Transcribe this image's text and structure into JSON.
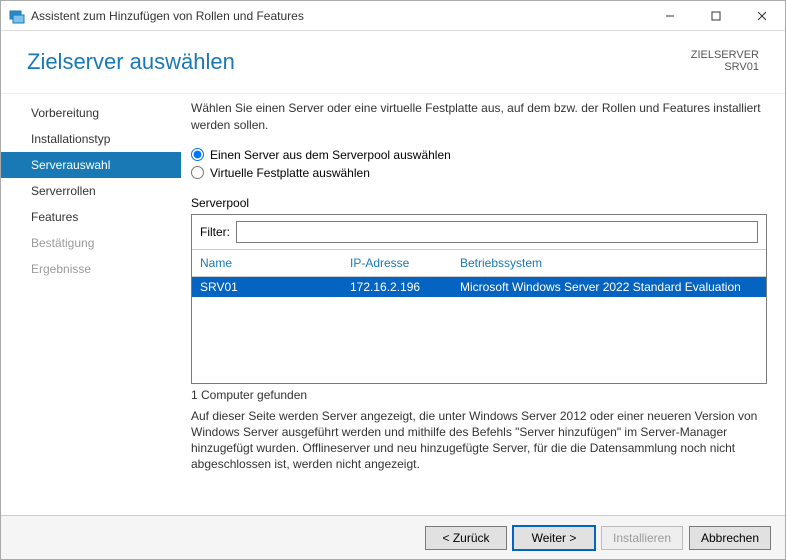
{
  "window": {
    "title": "Assistent zum Hinzufügen von Rollen und Features"
  },
  "header": {
    "page_title": "Zielserver auswählen",
    "destination_label": "ZIELSERVER",
    "destination_value": "SRV01"
  },
  "sidebar": {
    "items": [
      {
        "label": "Vorbereitung",
        "selected": false,
        "disabled": false
      },
      {
        "label": "Installationstyp",
        "selected": false,
        "disabled": false
      },
      {
        "label": "Serverauswahl",
        "selected": true,
        "disabled": false
      },
      {
        "label": "Serverrollen",
        "selected": false,
        "disabled": false
      },
      {
        "label": "Features",
        "selected": false,
        "disabled": false
      },
      {
        "label": "Bestätigung",
        "selected": false,
        "disabled": true
      },
      {
        "label": "Ergebnisse",
        "selected": false,
        "disabled": true
      }
    ]
  },
  "main": {
    "instruction": "Wählen Sie einen Server oder eine virtuelle Festplatte aus, auf dem bzw. der Rollen und Features installiert werden sollen.",
    "radio_pool": "Einen Server aus dem Serverpool auswählen",
    "radio_vhd": "Virtuelle Festplatte auswählen",
    "section_label": "Serverpool",
    "filter_label": "Filter:",
    "filter_value": "",
    "columns": {
      "name": "Name",
      "ip": "IP-Adresse",
      "os": "Betriebssystem"
    },
    "rows": [
      {
        "name": "SRV01",
        "ip": "172.16.2.196",
        "os": "Microsoft Windows Server 2022 Standard Evaluation",
        "selected": true
      }
    ],
    "found_text": "1 Computer gefunden",
    "footnote": "Auf dieser Seite werden Server angezeigt, die unter Windows Server 2012 oder einer neueren Version von Windows Server ausgeführt werden und mithilfe des Befehls \"Server hinzufügen\" im Server-Manager hinzugefügt wurden. Offlineserver und neu hinzugefügte Server, für die die Datensammlung noch nicht abgeschlossen ist, werden nicht angezeigt."
  },
  "footer": {
    "back": "< Zurück",
    "next": "Weiter >",
    "install": "Installieren",
    "cancel": "Abbrechen"
  }
}
